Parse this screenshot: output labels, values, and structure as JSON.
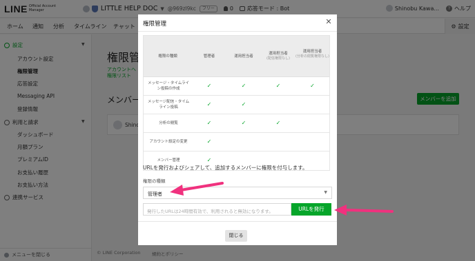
{
  "header": {
    "logo_text": "LINE",
    "logo_sub": "Official Account Manager",
    "account_name": "LITTLE HELP DOC",
    "account_id": "@969zl9kc",
    "plan_badge": "フリー",
    "friend_count": "0",
    "chat_mode": "応答モード : Bot",
    "user_name": "Shinobu Kawa...",
    "help_label": "ヘルプ"
  },
  "nav": {
    "tabs": [
      "ホーム",
      "通知",
      "分析",
      "タイムライン",
      "チャット"
    ],
    "settings_label": "設定"
  },
  "sidebar": {
    "settings_section": "設定",
    "settings_items": [
      "アカウント設定",
      "権限管理",
      "応答設定",
      "Messaging API",
      "登録情報"
    ],
    "billing_section": "利用と請求",
    "billing_items": [
      "ダッシュボード",
      "月額プラン",
      "プレミアムID",
      "お支払い履歴",
      "お支払い方法"
    ],
    "services_section": "連携サービス",
    "close_menu": "メニューを閉じる"
  },
  "main": {
    "title": "権限管理",
    "breadcrumb": "アカウントへ",
    "sub_link": "権限リスト",
    "members_heading": "メンバー",
    "add_member_button": "メンバーを追加",
    "member_name": "Shino"
  },
  "footer": {
    "copyright": "© LINE Corporation",
    "policy": "規約とポリシー"
  },
  "modal": {
    "title": "権限管理",
    "table": {
      "headers": [
        {
          "label": "権限の種類",
          "note": ""
        },
        {
          "label": "管理者",
          "note": ""
        },
        {
          "label": "運用担当者",
          "note": ""
        },
        {
          "label": "運用担当者",
          "note": "(配信権限なし)"
        },
        {
          "label": "運用担当者",
          "note": "(分析の閲覧権限なし)"
        }
      ],
      "rows": [
        {
          "label": "メッセージ・タイムライン投稿の作成",
          "checks": [
            true,
            true,
            true,
            true
          ]
        },
        {
          "label": "メッセージ配信・タイムライン投稿",
          "checks": [
            true,
            true,
            false,
            false
          ]
        },
        {
          "label": "分析の閲覧",
          "checks": [
            true,
            true,
            true,
            false
          ]
        },
        {
          "label": "アカウント設定の変更",
          "checks": [
            true,
            false,
            false,
            false
          ]
        },
        {
          "label": "メンバー管理",
          "checks": [
            true,
            false,
            false,
            false
          ]
        }
      ]
    },
    "intro_text": "URLを発行およびシェアして、追加するメンバーに権限を付与します。",
    "permission_label": "権限の種類",
    "permission_value": "管理者",
    "url_placeholder": "発行したURLは24時間有効で、利用されると無効になります。",
    "issue_button": "URLを発行",
    "close_button": "閉じる"
  },
  "annotations": {
    "arrow_color": "#f0317e"
  },
  "colors": {
    "brand_green": "#06a52a"
  }
}
